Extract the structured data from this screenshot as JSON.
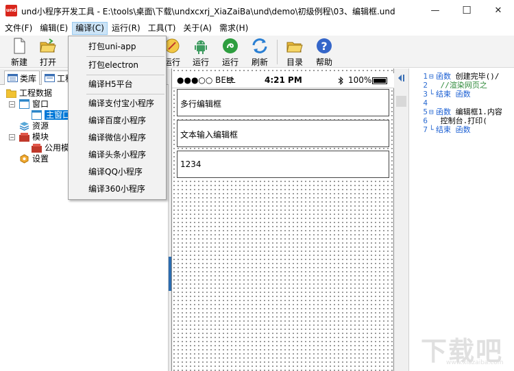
{
  "window": {
    "app_icon_text": "und",
    "title": "und小程序开发工具 - E:\\tools\\桌面\\下载\\undxcxrj_XiaZaiBa\\und\\demo\\初级例程\\03、编辑框.und",
    "min_glyph": "—",
    "max_glyph": "☐",
    "close_glyph": "✕"
  },
  "menubar": {
    "items": [
      "文件(F)",
      "编辑(E)",
      "编译(C)",
      "运行(R)",
      "工具(T)",
      "关于(A)",
      "需求(H)"
    ],
    "active": "编译(C)"
  },
  "compile_menu": {
    "items": [
      "打包uni-app",
      "打包electron",
      "编译H5平台",
      "编译支付宝小程序",
      "编译百度小程序",
      "编译微信小程序",
      "编译头条小程序",
      "编译QQ小程序",
      "编译360小程序"
    ]
  },
  "toolbar": {
    "new_label": "新建",
    "open_label": "打开",
    "run1_label": "运行",
    "run2_label": "运行",
    "run3_label": "运行",
    "refresh_label": "刷新",
    "catalog_label": "目录",
    "help_label": "帮助"
  },
  "left_panel": {
    "tab_library": "类库",
    "tab_project": "工程",
    "tree": {
      "root": "工程数据",
      "window": "窗口",
      "main_window": "主窗口",
      "resources": "资源",
      "modules": "模块",
      "public_module": "公用模",
      "settings": "设置"
    }
  },
  "designer": {
    "carrier": "●●●○○ BELL",
    "time": "4:21 PM",
    "battery": "100%",
    "boxes": [
      "多行编辑框",
      "文本输入编辑框",
      "1234"
    ]
  },
  "code": {
    "lines": [
      {
        "num": "1",
        "fold": "⊟",
        "kw": "函数",
        "text": " 创建完毕()/",
        "cls": ""
      },
      {
        "num": "2",
        "fold": "",
        "kw": "",
        "text": "   //渲染网页之",
        "cls": "cm"
      },
      {
        "num": "3",
        "fold": "└",
        "kw": "结束",
        "text": " 函数",
        "cls": "kw"
      },
      {
        "num": "4",
        "fold": "",
        "kw": "",
        "text": "",
        "cls": ""
      },
      {
        "num": "5",
        "fold": "⊟",
        "kw": "函数",
        "text": " 编辑框1.内容",
        "cls": ""
      },
      {
        "num": "6",
        "fold": "",
        "kw": "",
        "text": "   控制台.打印(",
        "cls": ""
      },
      {
        "num": "7",
        "fold": "└",
        "kw": "结束",
        "text": " 函数",
        "cls": "kw"
      }
    ]
  },
  "watermark": {
    "main": "下载吧",
    "sub": "www.xiazaiba.com"
  },
  "colors": {
    "accent": "#0078d7",
    "menu_active": "#cce4f7",
    "code_keyword": "#1b5fd3",
    "code_comment": "#2f8a3a"
  }
}
